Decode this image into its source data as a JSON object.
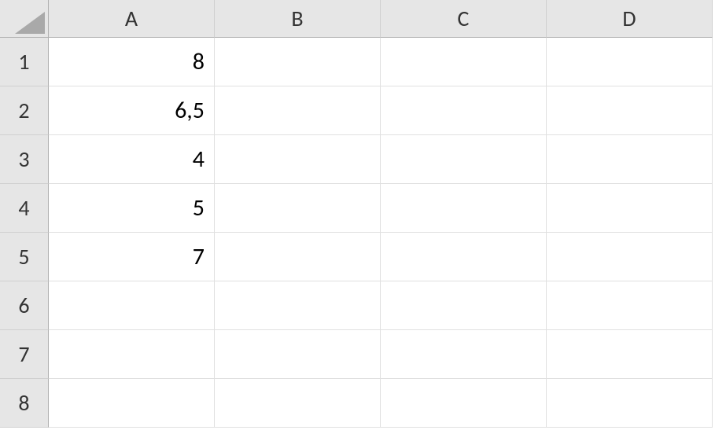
{
  "columns": [
    "A",
    "B",
    "C",
    "D"
  ],
  "rows": [
    "1",
    "2",
    "3",
    "4",
    "5",
    "6",
    "7",
    "8"
  ],
  "cells": {
    "A1": "8",
    "A2": "6,5",
    "A3": "4",
    "A4": "5",
    "A5": "7"
  }
}
